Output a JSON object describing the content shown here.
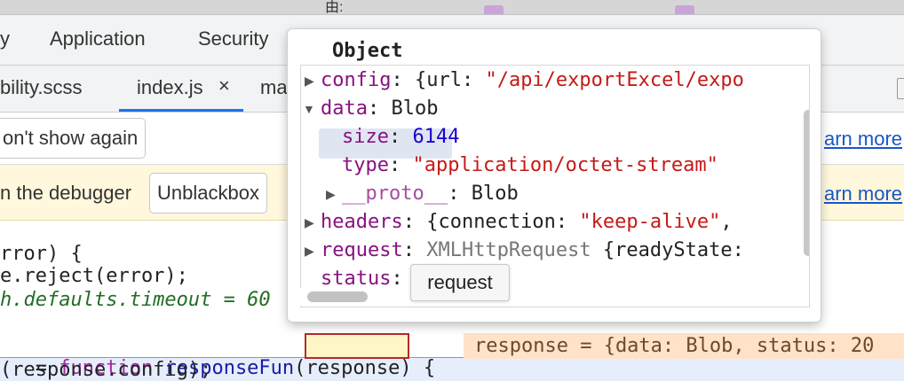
{
  "top_strip": {
    "fragment": "由:"
  },
  "main_tabs": [
    {
      "label": "y"
    },
    {
      "label": "Application"
    },
    {
      "label": "Security"
    }
  ],
  "file_tabs": [
    {
      "label": "bility.scss"
    },
    {
      "label": "index.js"
    },
    {
      "label": "ma"
    }
  ],
  "close_glyph": "×",
  "info_bar_1": {
    "button_label": "on't show again",
    "link": "arn more"
  },
  "info_bar_2": {
    "text": "n the debugger",
    "button_label": "Unblackbox",
    "link": "arn more"
  },
  "code": {
    "line1": "rror) {",
    "line2": "e.reject(error);",
    "line3": "h.defaults.timeout = 60",
    "line4_prefix": " = ",
    "line4_kw": "function",
    "line4_fn": "responseFun",
    "line4_paren_open": "(",
    "line4_param": "response",
    "line4_suffix": ") {",
    "line4_inline": "response = {data: Blob, status: 20",
    "line5": "(response.config);"
  },
  "popover": {
    "title": "Object",
    "rows": [
      {
        "key": "config",
        "value_prefix": ": {url: ",
        "value_str": "\"/api/exportExcel/expo"
      },
      {
        "key": "data",
        "value_prefix": ": Blob"
      },
      {
        "key": "size",
        "value_prefix": ": ",
        "value_num": "6144"
      },
      {
        "key": "type",
        "value_prefix": ": ",
        "value_str": "\"application/octet-stream\""
      },
      {
        "key": "__proto__",
        "value_prefix": ": Blob"
      },
      {
        "key": "headers",
        "value_prefix": ": {connection: ",
        "value_str": "\"keep-alive\"",
        "value_suffix": ","
      },
      {
        "key": "request",
        "value_prefix": ": ",
        "value_grey": "XMLHttpRequest",
        "value_suffix": " {readyState:"
      },
      {
        "key": "status",
        "value_prefix": ":"
      }
    ]
  },
  "tooltip": {
    "text": "request"
  },
  "colors": {
    "devtools_bg": "#f1f3f4",
    "warning_bar": "#fff8dc",
    "accent": "#1a73e8",
    "property": "#881280",
    "string": "#c41a16",
    "number": "#1c00cf",
    "inline_value_bg": "#ffe2c8"
  },
  "icons": [
    "close-icon",
    "expand-triangle-icon",
    "collapse-triangle-icon"
  ]
}
